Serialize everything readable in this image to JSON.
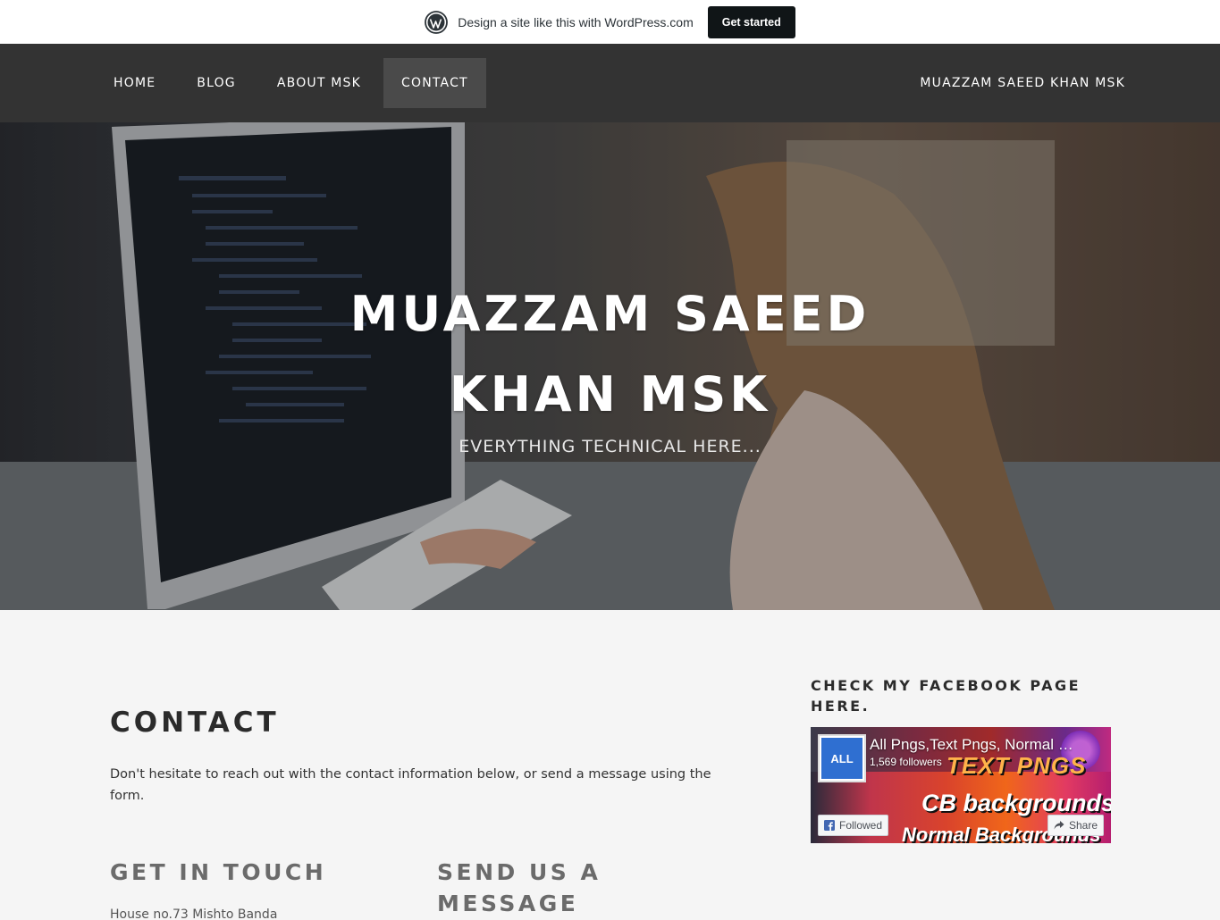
{
  "promo": {
    "text": "Design a site like this with WordPress.com",
    "cta": "Get started"
  },
  "nav": {
    "items": [
      {
        "label": "Home"
      },
      {
        "label": "Blog"
      },
      {
        "label": "About MSK"
      },
      {
        "label": "Contact",
        "active": true
      }
    ],
    "site_link": "Muazzam Saeed Khan MSK"
  },
  "hero": {
    "title_line1": "Muazzam Saeed",
    "title_line2": "Khan MSK",
    "tagline": "Everything Technical Here..."
  },
  "content": {
    "page_title": "Contact",
    "intro": "Don't hesitate to reach out with the contact information below, or send a message using the form.",
    "get_in_touch": "Get in Touch",
    "send_message": "Send Us a Message",
    "address": "House no.73 Mishto Banda"
  },
  "sidebar": {
    "widget_title": "Check my Facebook Page here.",
    "fb_page": {
      "name": "All Pngs,Text Pngs, Normal Backgrounds",
      "followers": "1,569 followers",
      "follow_label": "Followed",
      "share_label": "Share",
      "avatar_text": "ALL",
      "cover_art_lines": [
        "TEXT PNGS",
        "CB backgrounds",
        "Normal Backgrounds"
      ]
    }
  },
  "colors": {
    "nav_bg": "#333333",
    "nav_active_bg": "#4a4a4a",
    "page_bg": "#f5f5f5",
    "cta_bg": "#101517"
  }
}
